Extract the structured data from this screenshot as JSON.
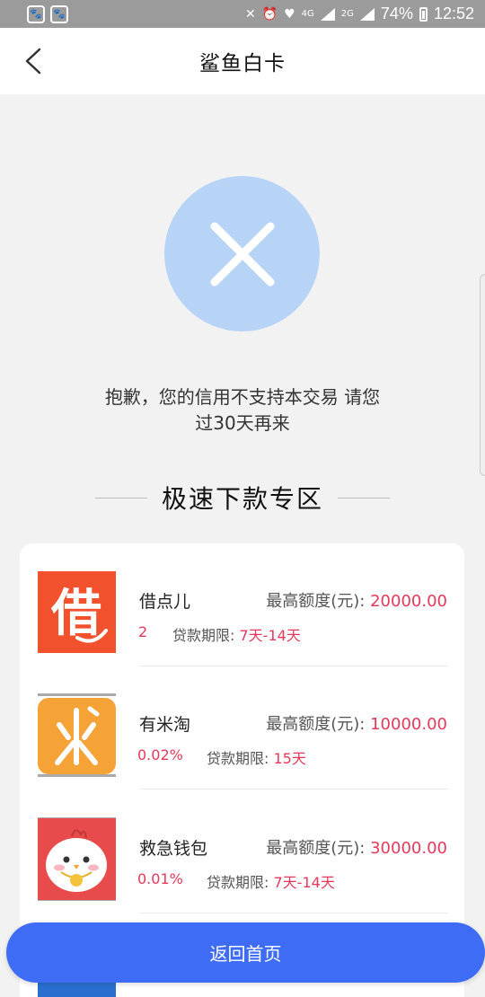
{
  "status_bar": {
    "battery": "74%",
    "time": "12:52",
    "network": "4G",
    "network2": "2G"
  },
  "header": {
    "title": "鲨鱼白卡"
  },
  "error": {
    "message_line1": "抱歉，您的信用不支持本交易 请您",
    "message_line2": "过30天再来"
  },
  "section": {
    "title": "极速下款专区"
  },
  "products": [
    {
      "name": "借点儿",
      "limit_label": "最高额度(元):",
      "limit_value": "20000.00",
      "rate": "2",
      "term_label": "贷款期限:",
      "term_value": "7天-14天",
      "logo_char": "借"
    },
    {
      "name": "有米淘",
      "limit_label": "最高额度(元):",
      "limit_value": "10000.00",
      "rate": "0.02%",
      "term_label": "贷款期限:",
      "term_value": "15天"
    },
    {
      "name": "救急钱包",
      "limit_label": "最高额度(元):",
      "limit_value": "30000.00",
      "rate": "0.01%",
      "term_label": "贷款期限:",
      "term_value": "7天-14天"
    }
  ],
  "bottom_button": {
    "label": "返回首页"
  },
  "colors": {
    "accent_red": "#e5395a",
    "button_blue": "#3f6cf4",
    "error_circle": "#b7d4f6"
  }
}
